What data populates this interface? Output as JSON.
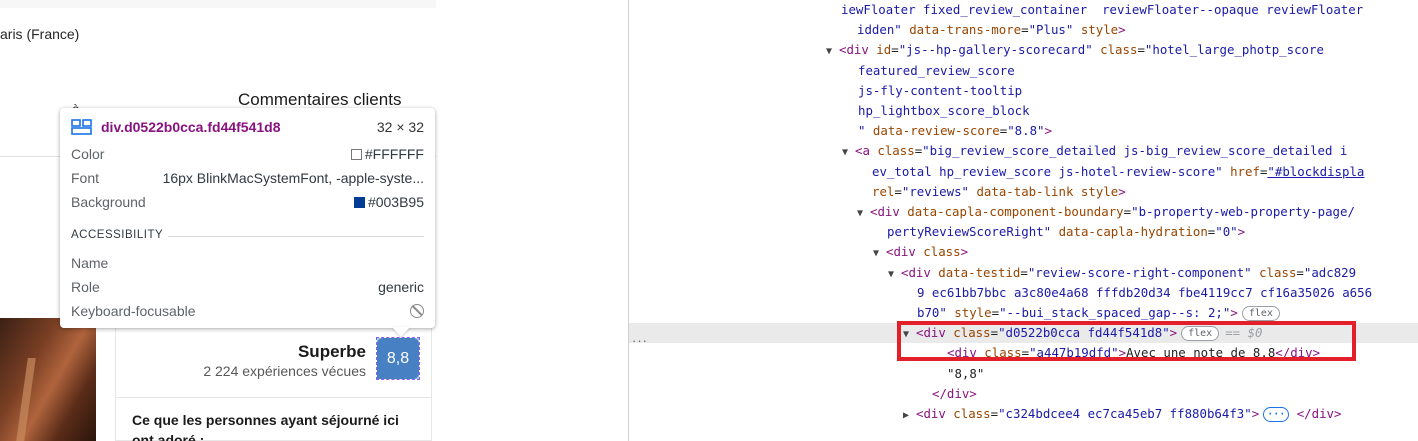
{
  "page": {
    "location_text": "aris (France)",
    "reviews_link": "Commentaires clients",
    "partial_glyph": "à",
    "score": {
      "word": "Superbe",
      "count": "2 224 expériences vécues",
      "value": "8,8"
    },
    "card_text": "Ce que les personnes ayant séjourné ici ont adoré :"
  },
  "tooltip": {
    "selector": "div.d0522b0cca.fd44f541d8",
    "dimensions": "32 × 32",
    "color_label": "Color",
    "color_value": "#FFFFFF",
    "font_label": "Font",
    "font_value": "16px BlinkMacSystemFont, -apple-syste...",
    "background_label": "Background",
    "background_value": "#003B95",
    "accessibility_title": "ACCESSIBILITY",
    "name_label": "Name",
    "name_value": "",
    "role_label": "Role",
    "role_value": "generic",
    "focusable_label": "Keyboard-focusable",
    "colors": {
      "color_swatch": "#FFFFFF",
      "background_swatch": "#003B95"
    }
  },
  "devtools": {
    "lines": [
      {
        "indent": 212,
        "parts": [
          [
            "val",
            "iewFloater fixed_review_container  reviewFloater--opaque reviewFloater"
          ]
        ]
      },
      {
        "indent": 228,
        "parts": [
          [
            "val",
            "idden\""
          ],
          [
            "attr",
            " data-trans-more"
          ],
          [
            "txt",
            "="
          ],
          [
            "val",
            "\"Plus\""
          ],
          [
            "attr",
            " style"
          ],
          [
            "tag",
            ">"
          ]
        ]
      },
      {
        "indent": 212,
        "tri": "▼",
        "parts": [
          [
            "tag",
            "<div"
          ],
          [
            "attr",
            " id"
          ],
          [
            "txt",
            "="
          ],
          [
            "val",
            "\"js--hp-gallery-scorecard\""
          ],
          [
            "attr",
            " class"
          ],
          [
            "txt",
            "="
          ],
          [
            "val",
            "\"hotel_large_photp_score"
          ]
        ]
      },
      {
        "indent": 229,
        "parts": [
          [
            "val",
            "featured_review_score"
          ]
        ]
      },
      {
        "indent": 229,
        "parts": [
          [
            "val",
            "js-fly-content-tooltip"
          ]
        ]
      },
      {
        "indent": 229,
        "parts": [
          [
            "val",
            "hp_lightbox_score_block"
          ]
        ]
      },
      {
        "indent": 229,
        "parts": [
          [
            "val",
            "\""
          ],
          [
            "attr",
            " data-review-score"
          ],
          [
            "txt",
            "="
          ],
          [
            "val",
            "\"8.8\""
          ],
          [
            "tag",
            ">"
          ]
        ]
      },
      {
        "indent": 228,
        "tri": "▼",
        "parts": [
          [
            "tag",
            "<a"
          ],
          [
            "attr",
            " class"
          ],
          [
            "txt",
            "="
          ],
          [
            "val",
            "\"big_review_score_detailed js-big_review_score_detailed i"
          ]
        ]
      },
      {
        "indent": 243,
        "parts": [
          [
            "val",
            "ev_total hp_review_score js-hotel-review-score\""
          ],
          [
            "attr",
            " href"
          ],
          [
            "txt",
            "="
          ],
          [
            "lnk",
            "\"#blockdispla"
          ]
        ]
      },
      {
        "indent": 243,
        "parts": [
          [
            "attr",
            "rel"
          ],
          [
            "txt",
            "="
          ],
          [
            "val",
            "\"reviews\""
          ],
          [
            "attr",
            " data-tab-link"
          ],
          [
            "attr",
            " style"
          ],
          [
            "tag",
            ">"
          ]
        ]
      },
      {
        "indent": 243,
        "tri": "▼",
        "parts": [
          [
            "tag",
            "<div"
          ],
          [
            "attr",
            " data-capla-component-boundary"
          ],
          [
            "txt",
            "="
          ],
          [
            "val",
            "\"b-property-web-property-page/"
          ]
        ]
      },
      {
        "indent": 258,
        "parts": [
          [
            "val",
            "pertyReviewScoreRight\""
          ],
          [
            "attr",
            " data-capla-hydration"
          ],
          [
            "txt",
            "="
          ],
          [
            "val",
            "\"0\""
          ],
          [
            "tag",
            ">"
          ]
        ]
      },
      {
        "indent": 259,
        "tri": "▼",
        "parts": [
          [
            "tag",
            "<div"
          ],
          [
            "attr",
            " class"
          ],
          [
            "tag",
            ">"
          ]
        ]
      },
      {
        "indent": 274,
        "tri": "▼",
        "parts": [
          [
            "tag",
            "<div"
          ],
          [
            "attr",
            " data-testid"
          ],
          [
            "txt",
            "="
          ],
          [
            "val",
            "\"review-score-right-component\""
          ],
          [
            "attr",
            " class"
          ],
          [
            "txt",
            "="
          ],
          [
            "val",
            "\"adc829"
          ]
        ]
      },
      {
        "indent": 288,
        "parts": [
          [
            "val",
            "9 ec61bb7bbc a3c80e4a68 fffdb20d34 fbe4119cc7 cf16a35026 a656"
          ]
        ]
      },
      {
        "indent": 288,
        "parts": [
          [
            "val",
            "b70\""
          ],
          [
            "attr",
            " style"
          ],
          [
            "txt",
            "="
          ],
          [
            "val",
            "\"--bui_stack_spaced_gap--s: 2;\""
          ],
          [
            "tag",
            ">"
          ]
        ],
        "badge": "flex"
      },
      {
        "indent": 289,
        "tri": "▼",
        "sel": true,
        "parts": [
          [
            "tag",
            "<div"
          ],
          [
            "attr",
            " class"
          ],
          [
            "txt",
            "="
          ],
          [
            "val",
            "\"d0522b0cca fd44f541d8\""
          ],
          [
            "tag",
            ">"
          ]
        ],
        "badge": "flex",
        "eq": "== $0"
      },
      {
        "indent": 318,
        "parts": [
          [
            "tag",
            "<div"
          ],
          [
            "attr",
            " class"
          ],
          [
            "txt",
            "="
          ],
          [
            "val",
            "\"a447b19dfd\""
          ],
          [
            "tag",
            ">"
          ],
          [
            "txt",
            "Avec une note de 8.8"
          ],
          [
            "tag",
            "</div>"
          ]
        ]
      },
      {
        "indent": 318,
        "parts": [
          [
            "txt",
            "\"8,8\""
          ]
        ]
      },
      {
        "indent": 303,
        "parts": [
          [
            "tag",
            "</div>"
          ]
        ]
      },
      {
        "indent": 289,
        "tri": "▶",
        "parts": [
          [
            "tag",
            "<div"
          ],
          [
            "attr",
            " class"
          ],
          [
            "txt",
            "="
          ],
          [
            "val",
            "\"c324bdcee4 ec7ca45eb7 ff880b64f3\""
          ],
          [
            "tag",
            ">"
          ]
        ],
        "dots": "···",
        "tail": " </div>"
      }
    ],
    "gutter_ellipsis": "···"
  }
}
